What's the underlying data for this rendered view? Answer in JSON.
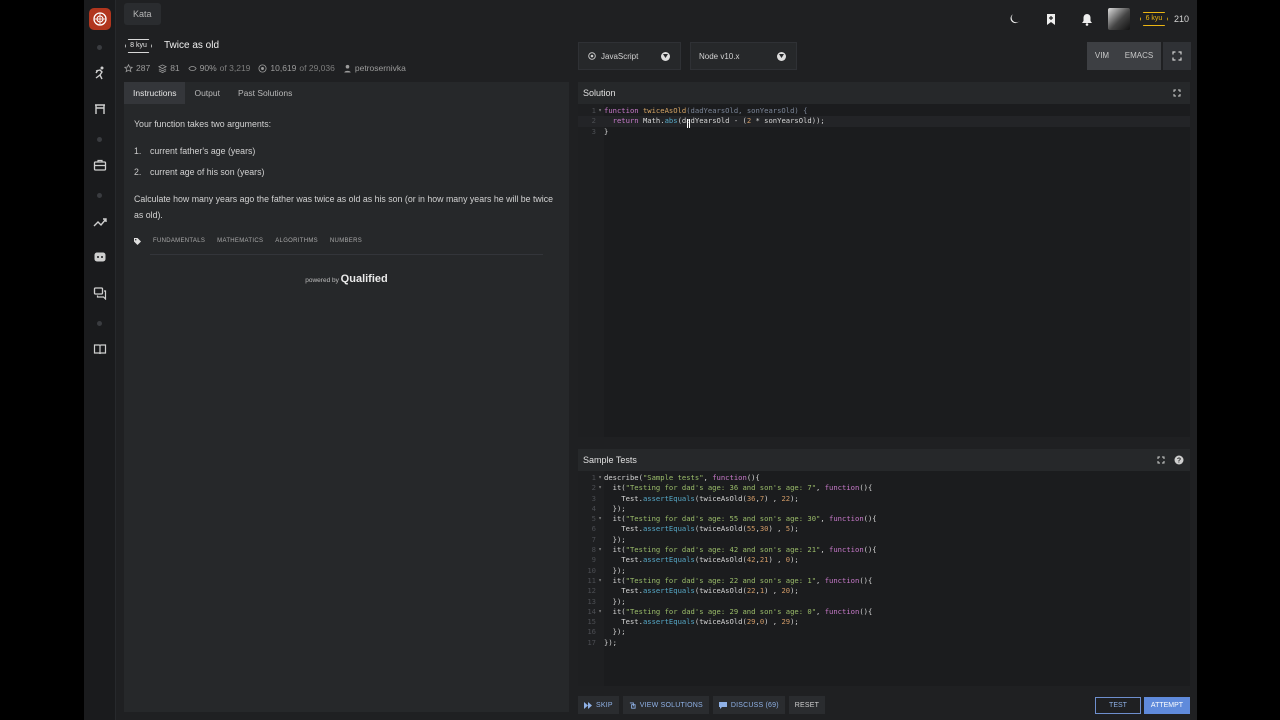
{
  "header": {
    "breadcrumb": "Kata",
    "rank": "6 kyu",
    "honor": "210"
  },
  "kata": {
    "kyu": "8 kyu",
    "title": "Twice as old",
    "stars": "287",
    "collections": "81",
    "satisfaction": "90%",
    "satisfaction_of": "of 3,219",
    "completed": "10,619",
    "completed_of": "of 29,036",
    "author": "petrosernivka"
  },
  "tabs": [
    "Instructions",
    "Output",
    "Past Solutions"
  ],
  "description": {
    "intro": "Your function takes two arguments:",
    "items": [
      {
        "num": "1.",
        "text": "current father's age (years)"
      },
      {
        "num": "2.",
        "text": "current age of his son (years)"
      }
    ],
    "question": "Calculate how many years ago the father was twice as old as his son (or in how many years he will be twice as old)."
  },
  "tags": [
    "FUNDAMENTALS",
    "MATHEMATICS",
    "ALGORITHMS",
    "NUMBERS"
  ],
  "powered_by": {
    "prefix": "powered by",
    "brand": "Qualified"
  },
  "editor": {
    "language": "JavaScript",
    "runtime": "Node v10.x",
    "modes": [
      "VIM",
      "EMACS"
    ],
    "solution_title": "Solution",
    "tests_title": "Sample Tests"
  },
  "solution_code": [
    {
      "n": "1",
      "fold": true,
      "html": "<span class='k'>function</span> <span class='f'>twiceAsOld</span><span class='p'>(dadYearsOld, sonYearsOld) {</span>"
    },
    {
      "n": "2",
      "fold": false,
      "hl": true,
      "html": "  <span class='k'>return</span> Math.<span class='m'>abs</span>(dadYearsOld - (<span class='n'>2</span> * sonYearsOld));"
    },
    {
      "n": "3",
      "fold": false,
      "html": "}"
    }
  ],
  "test_code": [
    {
      "n": "1",
      "fold": true,
      "html": "describe(<span class='s'>\"Sample tests\"</span>, <span class='k'>function</span>(){"
    },
    {
      "n": "2",
      "fold": true,
      "html": "  it(<span class='s'>\"Testing for dad's age: 36 and son's age: 7\"</span>, <span class='k'>function</span>(){"
    },
    {
      "n": "3",
      "fold": false,
      "html": "    Test.<span class='m'>assertEquals</span>(twiceAsOld(<span class='n'>36</span>,<span class='n'>7</span>) , <span class='n'>22</span>);"
    },
    {
      "n": "4",
      "fold": false,
      "html": "  });"
    },
    {
      "n": "5",
      "fold": true,
      "html": "  it(<span class='s'>\"Testing for dad's age: 55 and son's age: 30\"</span>, <span class='k'>function</span>(){"
    },
    {
      "n": "6",
      "fold": false,
      "html": "    Test.<span class='m'>assertEquals</span>(twiceAsOld(<span class='n'>55</span>,<span class='n'>30</span>) , <span class='n'>5</span>);"
    },
    {
      "n": "7",
      "fold": false,
      "html": "  });"
    },
    {
      "n": "8",
      "fold": true,
      "html": "  it(<span class='s'>\"Testing for dad's age: 42 and son's age: 21\"</span>, <span class='k'>function</span>(){"
    },
    {
      "n": "9",
      "fold": false,
      "html": "    Test.<span class='m'>assertEquals</span>(twiceAsOld(<span class='n'>42</span>,<span class='n'>21</span>) , <span class='n'>0</span>);"
    },
    {
      "n": "10",
      "fold": false,
      "html": "  });"
    },
    {
      "n": "11",
      "fold": true,
      "html": "  it(<span class='s'>\"Testing for dad's age: 22 and son's age: 1\"</span>, <span class='k'>function</span>(){"
    },
    {
      "n": "12",
      "fold": false,
      "html": "    Test.<span class='m'>assertEquals</span>(twiceAsOld(<span class='n'>22</span>,<span class='n'>1</span>) , <span class='n'>20</span>);"
    },
    {
      "n": "13",
      "fold": false,
      "html": "  });"
    },
    {
      "n": "14",
      "fold": true,
      "html": "  it(<span class='s'>\"Testing for dad's age: 29 and son's age: 0\"</span>, <span class='k'>function</span>(){"
    },
    {
      "n": "15",
      "fold": false,
      "html": "    Test.<span class='m'>assertEquals</span>(twiceAsOld(<span class='n'>29</span>,<span class='n'>0</span>) , <span class='n'>29</span>);"
    },
    {
      "n": "16",
      "fold": false,
      "html": "  });"
    },
    {
      "n": "17",
      "fold": false,
      "html": "});"
    }
  ],
  "actions": {
    "skip": "SKIP",
    "view_solutions": "VIEW SOLUTIONS",
    "discuss": "DISCUSS (69)",
    "reset": "RESET",
    "test": "TEST",
    "attempt": "ATTEMPT"
  },
  "colors": {
    "accent_blue": "#5f8adb",
    "rank_yellow": "#ecb613",
    "logo_red": "#b1361e"
  }
}
